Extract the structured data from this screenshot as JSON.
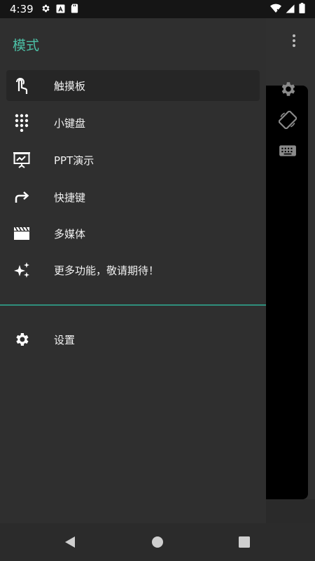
{
  "status_bar": {
    "time": "4:39"
  },
  "drawer": {
    "title": "模式",
    "items": [
      {
        "label": "触摸板",
        "icon": "touchpad-icon",
        "selected": true
      },
      {
        "label": "小键盘",
        "icon": "dialpad-icon",
        "selected": false
      },
      {
        "label": "PPT演示",
        "icon": "presentation-icon",
        "selected": false
      },
      {
        "label": "快捷键",
        "icon": "redo-arrow-icon",
        "selected": false
      },
      {
        "label": "多媒体",
        "icon": "clapperboard-icon",
        "selected": false
      },
      {
        "label": "更多功能，敬请期待！",
        "icon": "sparkle-icon",
        "selected": false
      }
    ],
    "settings_label": "设置"
  },
  "colors": {
    "accent": "#4cc0a6",
    "drawer_bg": "#2f2f2f",
    "divider": "#2f8f7c"
  }
}
